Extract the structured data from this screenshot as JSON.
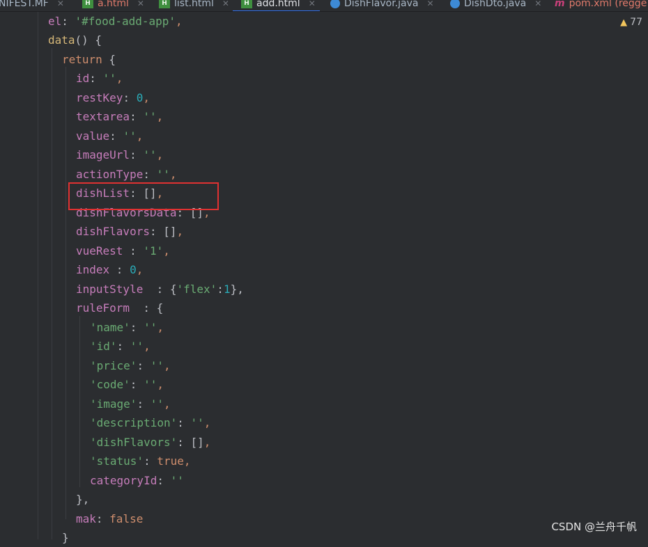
{
  "tabs": [
    {
      "label": "NIFEST.MF",
      "icon": "none",
      "active": false
    },
    {
      "label": "a.html",
      "icon": "html-file-icon",
      "active": false
    },
    {
      "label": "list.html",
      "icon": "html-file-icon",
      "active": false
    },
    {
      "label": "add.html",
      "icon": "html-file-icon",
      "active": true
    },
    {
      "label": "DishFlavor.java",
      "icon": "java-class-icon",
      "active": false
    },
    {
      "label": "DishDto.java",
      "icon": "java-class-icon",
      "active": false
    },
    {
      "label": "pom.xml (regge",
      "icon": "maven-icon",
      "active": false
    }
  ],
  "warnings": {
    "count": "77",
    "icon": "warning-triangle-icon"
  },
  "code": {
    "l01": {
      "key": "el",
      "sep": ": ",
      "val": "'#food-add-app'",
      "tail": ","
    },
    "l02": {
      "name": "data",
      "rest": "() {"
    },
    "l03": {
      "kw": "return",
      "rest": " {"
    },
    "l04": {
      "key": "id",
      "sep": ": ",
      "val": "''",
      "tail": ","
    },
    "l05": {
      "key": "restKey",
      "sep": ": ",
      "val": "0",
      "tail": ","
    },
    "l06": {
      "key": "textarea",
      "sep": ": ",
      "val": "''",
      "tail": ","
    },
    "l07": {
      "key": "value",
      "sep": ": ",
      "val": "''",
      "tail": ","
    },
    "l08": {
      "key": "imageUrl",
      "sep": ": ",
      "val": "''",
      "tail": ","
    },
    "l09": {
      "key": "actionType",
      "sep": ": ",
      "val": "''",
      "tail": ","
    },
    "l10": {
      "key": "dishList",
      "sep": ": ",
      "val": "[]",
      "tail": ","
    },
    "l11": {
      "key": "dishFlavorsData",
      "sep": ": ",
      "val": "[]",
      "tail": ","
    },
    "l12": {
      "key": "dishFlavors",
      "sep": ": ",
      "val": "[]",
      "tail": ","
    },
    "l13": {
      "key": "vueRest",
      "sep": " : ",
      "val": "'1'",
      "tail": ","
    },
    "l14": {
      "key": "index",
      "sep": " : ",
      "val": "0",
      "tail": ","
    },
    "l15": {
      "key": "inputStyle",
      "sep": "  : {",
      "k2": "'flex'",
      "c2": ":",
      "v2": "1",
      "tail": "},"
    },
    "l16": {
      "key": "ruleForm",
      "sep": "  : {"
    },
    "l17": {
      "key": "'name'",
      "sep": ": ",
      "val": "''",
      "tail": ","
    },
    "l18": {
      "key": "'id'",
      "sep": ": ",
      "val": "''",
      "tail": ","
    },
    "l19": {
      "key": "'price'",
      "sep": ": ",
      "val": "''",
      "tail": ","
    },
    "l20": {
      "key": "'code'",
      "sep": ": ",
      "val": "''",
      "tail": ","
    },
    "l21": {
      "key": "'image'",
      "sep": ": ",
      "val": "''",
      "tail": ","
    },
    "l22": {
      "key": "'description'",
      "sep": ": ",
      "val": "''",
      "tail": ","
    },
    "l23": {
      "key": "'dishFlavors'",
      "sep": ": ",
      "val": "[]",
      "tail": ","
    },
    "l24": {
      "key": "'status'",
      "sep": ": ",
      "val": "true",
      "tail": ","
    },
    "l25": {
      "key": "categoryId",
      "sep": ": ",
      "val": "''"
    },
    "l26": {
      "text": "},"
    },
    "l27": {
      "key": "mak",
      "sep": ": ",
      "val": "false"
    },
    "l28": {
      "text": "}"
    }
  },
  "watermark": "CSDN @兰舟千帆",
  "colors": {
    "background": "#2b2d30",
    "keyword": "#cf8e6d",
    "property": "#c77dbb",
    "string": "#6aab73",
    "number": "#2aacb8",
    "highlight_box": "#e03131"
  }
}
